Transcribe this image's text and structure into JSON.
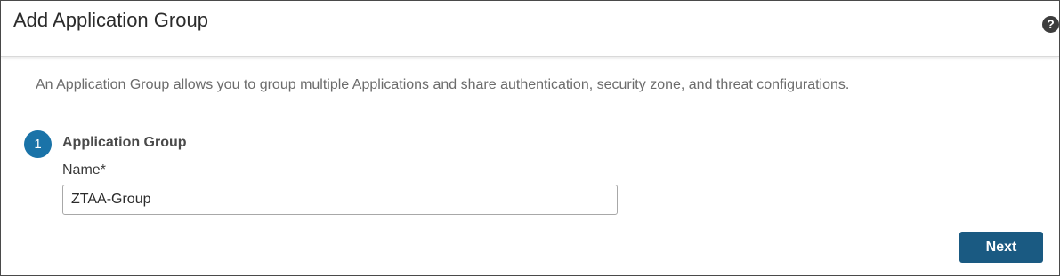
{
  "dialog": {
    "title": "Add Application Group",
    "help_icon": "help-icon",
    "description": "An Application Group allows you to group multiple Applications and share authentication, security zone, and threat configurations."
  },
  "step": {
    "number": "1",
    "title": "Application Group"
  },
  "name_field": {
    "label": "Name",
    "required_marker": "*",
    "value": "ZTAA-Group"
  },
  "actions": {
    "next_label": "Next"
  },
  "colors": {
    "accent": "#1a73a8",
    "button": "#1a5a82"
  }
}
